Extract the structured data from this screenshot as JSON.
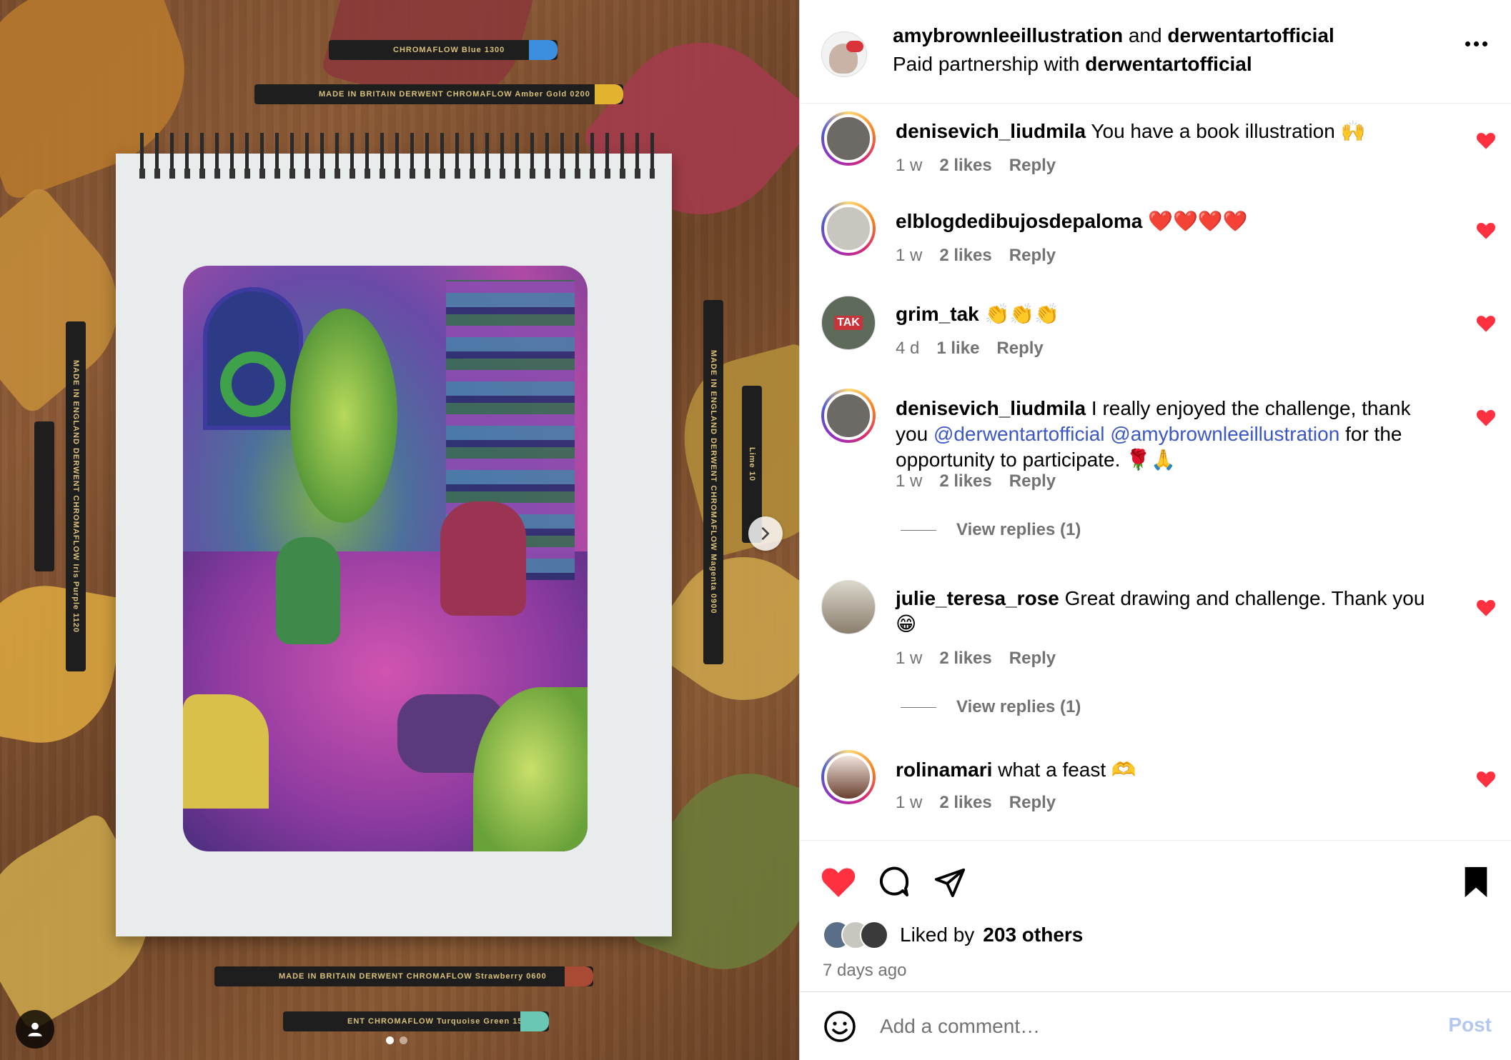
{
  "header": {
    "author": "amybrownleeillustration",
    "connector": "and",
    "collaborator": "derwentartofficial",
    "partnership_prefix": "Paid partnership with",
    "partner": "derwentartofficial"
  },
  "pencils": {
    "top1": "CHROMAFLOW   Blue 1300",
    "top2": "MADE IN BRITAIN   DERWENT CHROMAFLOW   Amber Gold 0200",
    "left1": "MADE IN ENGLAND   DERWENT CHROMAFLOW   Iris Purple 1120",
    "right1": "MADE IN ENGLAND   DERWENT CHROMAFLOW   Magenta 0900",
    "right2": "Lime 10",
    "bottom1": "MADE IN BRITAIN   DERWENT CHROMAFLOW   Strawberry 0600",
    "bottom2": "ENT CHROMAFLOW   Turquoise Green 1500"
  },
  "comments": [
    {
      "user": "denisevich_liudmila",
      "text": "You have a book illustration 🙌",
      "time": "1 w",
      "likes": "2 likes",
      "reply": "Reply"
    },
    {
      "user": "elblogdedibujosdepaloma",
      "text": "❤️❤️❤️❤️",
      "time": "1 w",
      "likes": "2 likes",
      "reply": "Reply"
    },
    {
      "user": "grim_tak",
      "text": "👏👏👏",
      "time": "4 d",
      "likes": "1 like",
      "reply": "Reply"
    },
    {
      "user": "denisevich_liudmila",
      "text_a": "I really enjoyed the challenge, thank you",
      "mention1": "@derwentartofficial",
      "mention2": "@amybrownleeillustration",
      "text_b": "for the opportunity to participate. 🌹🙏",
      "time": "1 w",
      "likes": "2 likes",
      "reply": "Reply",
      "view_replies": "View replies (1)"
    },
    {
      "user": "julie_teresa_rose",
      "text": "Great drawing and challenge. Thank you 😁",
      "time": "1 w",
      "likes": "2 likes",
      "reply": "Reply",
      "view_replies": "View replies (1)"
    },
    {
      "user": "rolinamari",
      "text": "what a feast 🫶",
      "time": "1 w",
      "likes": "2 likes",
      "reply": "Reply"
    }
  ],
  "avatar_badges": {
    "grim_tak": "TAK"
  },
  "likes": {
    "prefix": "Liked by",
    "count": "203 others"
  },
  "timestamp": "7 days ago",
  "add_comment": {
    "placeholder": "Add a comment…",
    "post_label": "Post"
  },
  "colors": {
    "like_red": "#ff3040",
    "mention_blue": "#3b57c8",
    "muted": "#737373",
    "post_disabled": "#b2c8f0"
  },
  "icons": [
    "heart-icon",
    "comment-icon",
    "share-icon",
    "bookmark-icon",
    "emoji-icon",
    "more-icon",
    "chevron-right-icon",
    "user-tag-icon"
  ]
}
